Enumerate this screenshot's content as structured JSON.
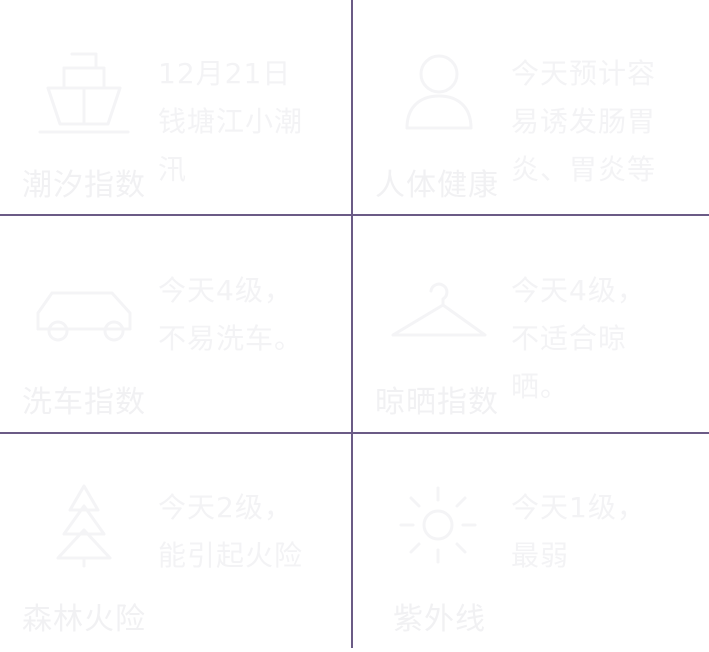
{
  "divider_color": "#6b5b86",
  "text_color": "#f1f1f3",
  "cells": [
    {
      "icon": "ship-icon",
      "label": "潮汐指数",
      "desc": "12月21日钱塘江小潮汛"
    },
    {
      "icon": "person-icon",
      "label": "人体健康",
      "desc": "今天预计容易诱发肠胃炎、胃炎等"
    },
    {
      "icon": "car-icon",
      "label": "洗车指数",
      "desc": "今天4级，不易洗车。"
    },
    {
      "icon": "hanger-icon",
      "label": "晾晒指数",
      "desc": "今天4级，不适合晾晒。"
    },
    {
      "icon": "tree-icon",
      "label": "森林火险",
      "desc": "今天2级，能引起火险"
    },
    {
      "icon": "sun-icon",
      "label": "紫外线",
      "desc": "今天1级，最弱"
    }
  ]
}
